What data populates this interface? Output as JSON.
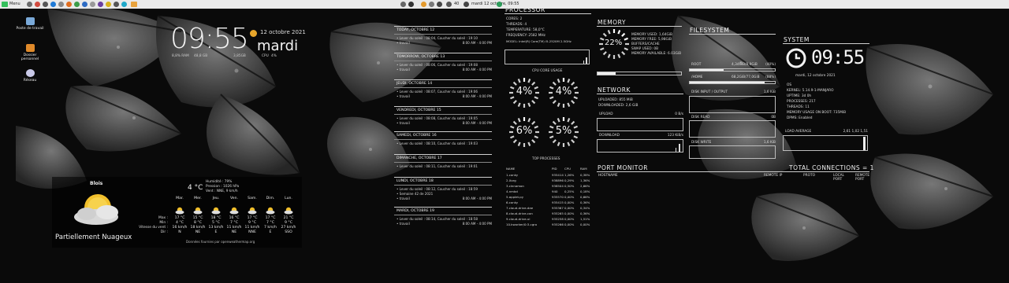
{
  "panel": {
    "menu_label": "Menu",
    "clock": "mardi 12 octobre, 09:55",
    "volume": "40"
  },
  "desktop": {
    "icons": [
      {
        "label": "Poste de travail",
        "icon": "computer-icon"
      },
      {
        "label": "Dossier personnel",
        "icon": "home-folder-icon"
      },
      {
        "label": "Réseau",
        "icon": "network-icon"
      }
    ]
  },
  "clockwidget": {
    "time": "09:55",
    "date": "12 octobre 2021",
    "day": "mardi",
    "stats": [
      "8,8% RAM",
      "48,8 GB",
      "3,85GB",
      "CPU",
      "4%"
    ]
  },
  "weather": {
    "city": "Blois",
    "temp": "4 °C",
    "humidity": "Humidité : 79%",
    "pressure": "Pression : 1026 hPa",
    "wind": "Vent : NNE, 9 km/h",
    "condition": "Partiellement Nuageux",
    "row_labels": [
      "Max :",
      "Min :",
      "Vitesse du vent :",
      "Dir :"
    ],
    "days": [
      {
        "name": "Mar.",
        "max": "17 °C",
        "min": "4 °C",
        "speed": "16 km/h",
        "dir": "N"
      },
      {
        "name": "Mer.",
        "max": "15 °C",
        "min": "8 °C",
        "speed": "18 km/h",
        "dir": "NE"
      },
      {
        "name": "Jeu.",
        "max": "18 °C",
        "min": "5 °C",
        "speed": "13 km/h",
        "dir": "E"
      },
      {
        "name": "Ven.",
        "max": "16 °C",
        "min": "7 °C",
        "speed": "11 km/h",
        "dir": "NE"
      },
      {
        "name": "Sam.",
        "max": "17 °C",
        "min": "9 °C",
        "speed": "11 km/h",
        "dir": "NNE"
      },
      {
        "name": "Dim.",
        "max": "17 °C",
        "min": "7 °C",
        "speed": "7 km/h",
        "dir": "E"
      },
      {
        "name": "Lun.",
        "max": "21 °C",
        "min": "9 °C",
        "speed": "27 km/h",
        "dir": "SSO"
      }
    ],
    "footer": "Données fournies par openweathermap.org"
  },
  "calendar": [
    {
      "date": "TODAY, OCTOBRE 12",
      "sun": "• Lever du soleil : 08:04, Coucher du soleil : 19:10",
      "task": "• travail",
      "time": "8:00 AM - 4:00 PM"
    },
    {
      "date": "TOMORROW, OCTOBRE 13",
      "sun": "• Lever du soleil : 08:06, Coucher du soleil : 19:08",
      "task": "• travail",
      "time": "8:00 AM - 4:00 PM"
    },
    {
      "date": "JEUDI, OCTOBRE 14",
      "sun": "• Lever du soleil : 08:07, Coucher du soleil : 19:06",
      "task": "• travail",
      "time": "8:00 AM - 4:00 PM"
    },
    {
      "date": "VENDREDI, OCTOBRE 15",
      "sun": "• Lever du soleil : 08:08, Coucher du soleil : 19:05",
      "task": "• travail",
      "time": "8:00 AM - 4:00 PM"
    },
    {
      "date": "SAMEDI, OCTOBRE 16",
      "sun": "• Lever du soleil : 08:10, Coucher du soleil : 19:03",
      "task": "",
      "time": ""
    },
    {
      "date": "DIMANCHE, OCTOBRE 17",
      "sun": "• Lever du soleil : 08:11, Coucher du soleil : 19:01",
      "task": "",
      "time": ""
    },
    {
      "date": "LUNDI, OCTOBRE 18",
      "sun": "• Lever du soleil : 08:12, Coucher du soleil : 18:59",
      "task2": "• Semaine 42 de 2021",
      "task": "• travail",
      "time": "8:00 AM - 4:00 PM"
    },
    {
      "date": "MARDI, OCTOBRE 19",
      "sun": "• Lever du soleil : 08:14, Coucher du soleil : 18:58",
      "task": "• travail",
      "time": "8:00 AM - 4:00 PM"
    }
  ],
  "processor": {
    "title": "PROCESSOR",
    "lines": [
      "CORES: 2",
      "THREADS: 4",
      "TEMPERATURE: 58,0°C",
      "FREQUENCY: 2582 MHz",
      "MODEL: Intel(R) Core(TM) i5-2520M 2.5GHz"
    ],
    "core_usage_label": "CPU CORE USAGE",
    "cores": [
      4,
      4,
      6,
      5
    ],
    "core_labels": [
      "4%",
      "4%",
      "6%",
      "5%"
    ],
    "top_label": "TOP PROCESSES",
    "headers": [
      "NAME",
      "PID",
      "CPU",
      "RAM"
    ],
    "processes": [
      [
        "1.conky",
        "935414",
        "1,26%",
        "0,38%"
      ],
      [
        "2.Xorg",
        "938896",
        "0,29%",
        "1,36%"
      ],
      [
        "3.cinnamon",
        "938504",
        "0,50%",
        "2,66%"
      ],
      [
        "4.nmbd",
        "940",
        "0,25%",
        "0,18%"
      ],
      [
        "5.applet.py",
        "935570",
        "0,00%",
        "0,66%"
      ],
      [
        "6.conky",
        "935415",
        "0,00%",
        "0,36%"
      ],
      [
        "7.cloud-drive-dae",
        "935367",
        "0,00%",
        "0,34%"
      ],
      [
        "8.cloud-drive-con",
        "935265",
        "0,00%",
        "0,36%"
      ],
      [
        "9.cloud-drive-ui",
        "935258",
        "0,00%",
        "1,51%"
      ],
      [
        "10.kworker/0:3-cgro",
        "935266",
        "0,00%",
        "0,00%"
      ]
    ]
  },
  "memory": {
    "title": "MEMORY",
    "percent": 22,
    "percent_label": "22%",
    "lines": [
      "MEMORY USED: 1,64GiB",
      "MEMORY FREE: 5,98GiB",
      "BUFFERS/CACHE",
      "SWAP USED: 0B",
      "MEMORY AVAILABLE: 6.03GiB"
    ],
    "bar_fraction": 0.22
  },
  "network": {
    "title": "NETWORK",
    "uploaded": "UPLOADED: 855 MiB",
    "downloaded": "DOWNLOADED: 2,6 GiB",
    "upload_label": "UPLOAD",
    "upload_rate": "0 B/s",
    "download_label": "DOWNLOAD",
    "download_rate": "123 KiB/s"
  },
  "filesystem": {
    "title": "FILESYSTEM",
    "root_label": "ROOT",
    "root_value": "4,34GiB/8,9GiB",
    "root_pct": "(40%)",
    "root_fraction": 0.4,
    "home_label": "/HOME",
    "home_value": "68,2GiB/77,0GiB",
    "home_pct": "(88%)",
    "home_fraction": 0.88,
    "io_label": "DISK INPUT / OUTPUT",
    "io_value": "1,6 KiB",
    "read_label": "DISK READ",
    "read_value": "0B",
    "write_label": "DISK WRITE",
    "write_value": "1,6 KiB"
  },
  "system": {
    "title": "SYSTEM",
    "time": "09:55",
    "date": "mardi, 12 octobre 2021",
    "lines": [
      "OS",
      "KERNEL: 5.14.9-1-MANJARO",
      "UPTIME: 3d 0h",
      "PROCESSES: 217",
      "THREADS: 11",
      "MEMORY USAGE ON BOOT: 735MiB",
      "DPMS: Enabled"
    ],
    "load_label": "LOAD AVERAGE",
    "load_value": "2,61 1,02 1,51"
  },
  "portmonitor": {
    "title": "PORT MONITOR",
    "connections": "TOTAL CONNECTIONS = 1",
    "headers": [
      "HOSTNAME",
      "REMOTE IP",
      "PROTO",
      "LOCAL PORT",
      "REMOTE PORT"
    ]
  }
}
